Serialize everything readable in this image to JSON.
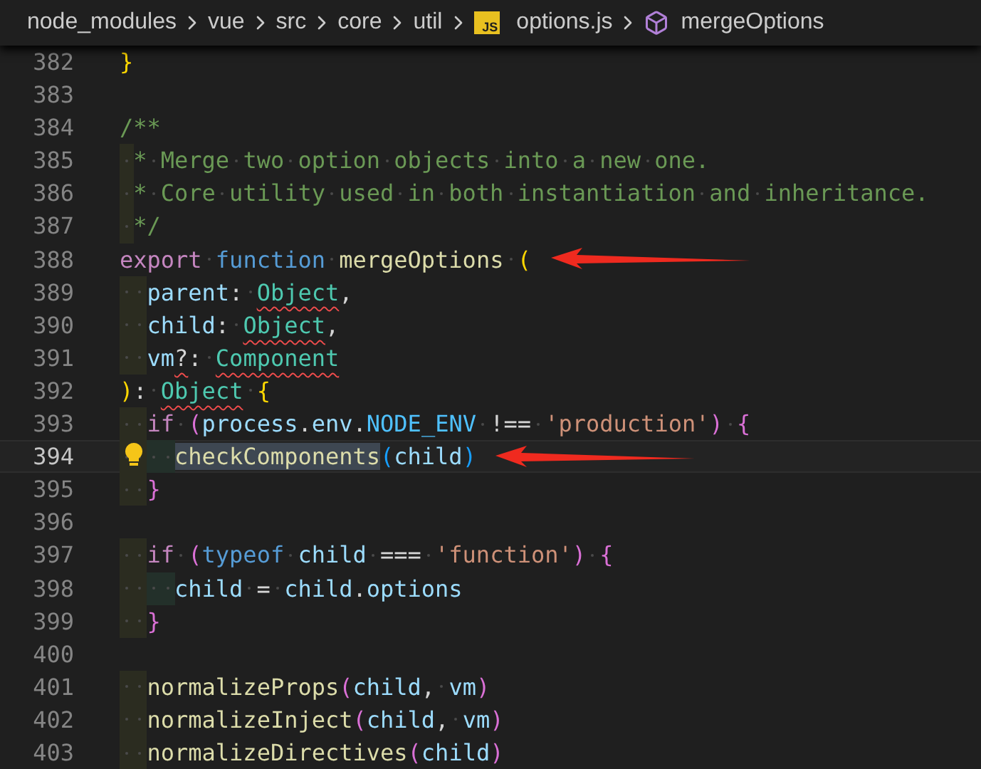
{
  "breadcrumb": [
    {
      "label": "node_modules",
      "kind": "folder"
    },
    {
      "label": "vue",
      "kind": "folder"
    },
    {
      "label": "src",
      "kind": "folder"
    },
    {
      "label": "core",
      "kind": "folder"
    },
    {
      "label": "util",
      "kind": "folder"
    },
    {
      "label": "options.js",
      "kind": "file",
      "icon_text": "JS"
    },
    {
      "label": "mergeOptions",
      "kind": "symbol"
    }
  ],
  "lines": [
    {
      "number": "382",
      "current": false,
      "lightbulb": false,
      "arrow": false,
      "tokens": [
        {
          "text": "}",
          "kind": "bracket1"
        }
      ]
    },
    {
      "number": "383",
      "current": false,
      "lightbulb": false,
      "arrow": false
    },
    {
      "number": "384",
      "current": false,
      "lightbulb": false,
      "arrow": false,
      "tokens": [
        {
          "text": "/**",
          "kind": "comment"
        }
      ]
    },
    {
      "number": "385",
      "current": false,
      "lightbulb": false,
      "arrow": false,
      "tokens": [
        {
          "text": " * Merge two option objects into a new one.",
          "kind": "comment"
        }
      ]
    },
    {
      "number": "386",
      "current": false,
      "lightbulb": false,
      "arrow": false,
      "tokens": [
        {
          "text": " * Core utility used in both instantiation and inheritance.",
          "kind": "comment"
        }
      ]
    },
    {
      "number": "387",
      "current": false,
      "lightbulb": false,
      "arrow": false,
      "tokens": [
        {
          "text": " */",
          "kind": "comment"
        }
      ]
    },
    {
      "number": "388",
      "current": false,
      "lightbulb": false,
      "arrow": true,
      "tokens": [
        {
          "text": "export",
          "kind": "control"
        },
        {
          "text": " function",
          "kind": "keyword"
        },
        {
          "text": " mergeOptions",
          "kind": "function"
        },
        {
          "text": " (",
          "kind": "bracket1"
        }
      ]
    },
    {
      "number": "389",
      "current": false,
      "lightbulb": false,
      "arrow": false,
      "tokens": [
        {
          "text": "  parent",
          "kind": "variable"
        },
        {
          "text": ": ",
          "kind": "punct"
        },
        {
          "text": "Object",
          "kind": "type_error"
        },
        {
          "text": ",",
          "kind": "punct"
        }
      ]
    },
    {
      "number": "390",
      "current": false,
      "lightbulb": false,
      "arrow": false,
      "tokens": [
        {
          "text": "  child",
          "kind": "variable"
        },
        {
          "text": ": ",
          "kind": "punct"
        },
        {
          "text": "Object",
          "kind": "type_error"
        },
        {
          "text": ",",
          "kind": "punct"
        }
      ]
    },
    {
      "number": "391",
      "current": false,
      "lightbulb": false,
      "arrow": false,
      "tokens": [
        {
          "text": "  vm",
          "kind": "variable"
        },
        {
          "text": "?",
          "kind": "punct_error"
        },
        {
          "text": ": ",
          "kind": "punct"
        },
        {
          "text": "Component",
          "kind": "type_error"
        }
      ]
    },
    {
      "number": "392",
      "current": false,
      "lightbulb": false,
      "arrow": false,
      "tokens": [
        {
          "text": ")",
          "kind": "bracket1"
        },
        {
          "text": ": ",
          "kind": "punct"
        },
        {
          "text": "Object",
          "kind": "type_error"
        },
        {
          "text": " {",
          "kind": "bracket1"
        }
      ]
    },
    {
      "number": "393",
      "current": false,
      "lightbulb": false,
      "arrow": false,
      "tokens": [
        {
          "text": "  if",
          "kind": "control"
        },
        {
          "text": " (",
          "kind": "bracket2"
        },
        {
          "text": "process",
          "kind": "variable"
        },
        {
          "text": ".",
          "kind": "punct"
        },
        {
          "text": "env",
          "kind": "variable"
        },
        {
          "text": ".",
          "kind": "punct"
        },
        {
          "text": "NODE_ENV",
          "kind": "constant"
        },
        {
          "text": " !== ",
          "kind": "punct"
        },
        {
          "text": "'production'",
          "kind": "string"
        },
        {
          "text": ")",
          "kind": "bracket2"
        },
        {
          "text": " {",
          "kind": "bracket2"
        }
      ]
    },
    {
      "number": "394",
      "current": true,
      "lightbulb": true,
      "arrow": true,
      "tokens": [
        {
          "text": "    checkComponents",
          "kind": "function_selected"
        },
        {
          "text": "(",
          "kind": "bracket3"
        },
        {
          "text": "child",
          "kind": "variable"
        },
        {
          "text": ")",
          "kind": "bracket3"
        }
      ]
    },
    {
      "number": "395",
      "current": false,
      "lightbulb": false,
      "arrow": false,
      "tokens": [
        {
          "text": "  }",
          "kind": "bracket2"
        }
      ]
    },
    {
      "number": "396",
      "current": false,
      "lightbulb": false,
      "arrow": false
    },
    {
      "number": "397",
      "current": false,
      "lightbulb": false,
      "arrow": false,
      "tokens": [
        {
          "text": "  if",
          "kind": "control"
        },
        {
          "text": " (",
          "kind": "bracket2"
        },
        {
          "text": "typeof",
          "kind": "keyword"
        },
        {
          "text": " child",
          "kind": "variable"
        },
        {
          "text": " === ",
          "kind": "punct"
        },
        {
          "text": "'function'",
          "kind": "string"
        },
        {
          "text": ")",
          "kind": "bracket2"
        },
        {
          "text": " {",
          "kind": "bracket2"
        }
      ]
    },
    {
      "number": "398",
      "current": false,
      "lightbulb": false,
      "arrow": false,
      "tokens": [
        {
          "text": "    child",
          "kind": "variable"
        },
        {
          "text": " = ",
          "kind": "punct"
        },
        {
          "text": "child",
          "kind": "variable"
        },
        {
          "text": ".",
          "kind": "punct"
        },
        {
          "text": "options",
          "kind": "variable"
        }
      ]
    },
    {
      "number": "399",
      "current": false,
      "lightbulb": false,
      "arrow": false,
      "tokens": [
        {
          "text": "  }",
          "kind": "bracket2"
        }
      ]
    },
    {
      "number": "400",
      "current": false,
      "lightbulb": false,
      "arrow": false
    },
    {
      "number": "401",
      "current": false,
      "lightbulb": false,
      "arrow": false,
      "tokens": [
        {
          "text": "  normalizeProps",
          "kind": "function"
        },
        {
          "text": "(",
          "kind": "bracket2"
        },
        {
          "text": "child",
          "kind": "variable"
        },
        {
          "text": ", ",
          "kind": "punct"
        },
        {
          "text": "vm",
          "kind": "variable"
        },
        {
          "text": ")",
          "kind": "bracket2"
        }
      ]
    },
    {
      "number": "402",
      "current": false,
      "lightbulb": false,
      "arrow": false,
      "tokens": [
        {
          "text": "  normalizeInject",
          "kind": "function"
        },
        {
          "text": "(",
          "kind": "bracket2"
        },
        {
          "text": "child",
          "kind": "variable"
        },
        {
          "text": ", ",
          "kind": "punct"
        },
        {
          "text": "vm",
          "kind": "variable"
        },
        {
          "text": ")",
          "kind": "bracket2"
        }
      ]
    },
    {
      "number": "403",
      "current": false,
      "lightbulb": false,
      "arrow": false,
      "tokens": [
        {
          "text": "  normalizeDirectives",
          "kind": "function"
        },
        {
          "text": "(",
          "kind": "bracket2"
        },
        {
          "text": "child",
          "kind": "variable"
        },
        {
          "text": ")",
          "kind": "bracket2"
        }
      ]
    }
  ]
}
